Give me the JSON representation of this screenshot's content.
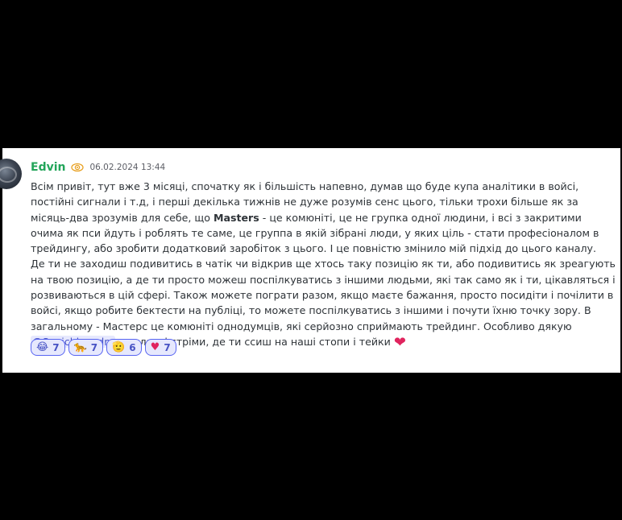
{
  "message": {
    "author": "Edvin",
    "timestamp": "06.02.2024 13:44",
    "role_icon": "nazar-amulet-icon",
    "colors": {
      "author": "#23a55a",
      "mention_bg": "#e6e8fd",
      "mention_text": "#4752c4",
      "heart": "#e0245e"
    },
    "para1": {
      "before_bold": "Всім привіт, тут вже 3 місяці, спочатку як і більшість напевно, думав що буде купа аналітики в войсі, постійні сигнали і т.д, і перші декілька тижнів не дуже розумів сенс цього, тільки трохи більше як за місяць-два зрозумів для себе, що ",
      "bold": "Masters",
      "after_bold": " - це комюніті, це не групка одної людини, і всі з закритими очима як пси йдуть і роблять те саме, це группа в якій зібрані люди, у яких ціль - стати професіоналом в трейдингу, або зробити додатковий заробіток з цього. І це повністю змінило мій підхід до цього каналу."
    },
    "para2": {
      "before_mention": "Де ти не заходиш подивитись в чатік чи відкрив ще хтось таку позицію як ти, або подивитись як зреагують на твою позицію, а де ти просто можеш поспілкуватись з іншими людьми, які так само як і ти, цікавляться і розвиваються в цій сфері. Також можете пограти разом, якщо маєте бажання, просто посидіти і почілити в войсі, якщо робите бектести на публіці, то можете поспілкуватись з іншими і почути їхню точку зору. В загальному - Мастерс це комюніті однодумців, які серйозно сприймають трейдинг. Особливо дякую ",
      "mention": "@Sanichka.adm",
      "after_mention": " за класні стріми, де ти ссиш на наші стопи і тейки",
      "end_emoji": "❤",
      "end_emoji_name": "red-heart-icon"
    },
    "reactions": [
      {
        "emoji": "😂",
        "name": "laughing-emoji",
        "count": "7"
      },
      {
        "emoji": "🐆",
        "name": "leopard-emoji",
        "count": "7"
      },
      {
        "emoji": "🫡",
        "name": "saluting-face-emoji",
        "count": "6"
      },
      {
        "emoji": "♥",
        "name": "heart-emoji",
        "count": "7"
      }
    ]
  }
}
